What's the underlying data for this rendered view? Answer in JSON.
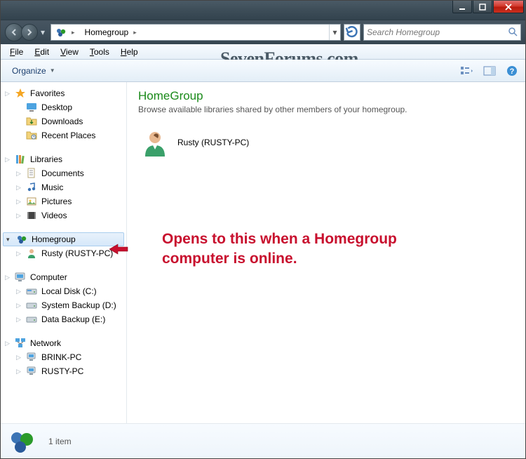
{
  "titlebar": {},
  "nav": {
    "breadcrumb_root_icon": "homegroup-icon",
    "breadcrumb": "Homegroup",
    "search_placeholder": "Search Homegroup"
  },
  "menu": {
    "file": "File",
    "edit": "Edit",
    "view": "View",
    "tools": "Tools",
    "help": "Help"
  },
  "watermark": "SevenForums.com",
  "toolbar": {
    "organize": "Organize"
  },
  "sidebar": {
    "favorites": {
      "label": "Favorites",
      "items": [
        "Desktop",
        "Downloads",
        "Recent Places"
      ]
    },
    "libraries": {
      "label": "Libraries",
      "items": [
        "Documents",
        "Music",
        "Pictures",
        "Videos"
      ]
    },
    "homegroup": {
      "label": "Homegroup",
      "items": [
        "Rusty (RUSTY-PC)"
      ]
    },
    "computer": {
      "label": "Computer",
      "items": [
        "Local Disk (C:)",
        "System Backup (D:)",
        "Data Backup (E:)"
      ]
    },
    "network": {
      "label": "Network",
      "items": [
        "BRINK-PC",
        "RUSTY-PC"
      ]
    }
  },
  "content": {
    "heading": "HomeGroup",
    "subhead": "Browse available libraries shared by other members of your homegroup.",
    "members": [
      {
        "name": "Rusty (RUSTY-PC)"
      }
    ]
  },
  "annotation": {
    "line1": "Opens to this when a Homegroup",
    "line2": "computer is online."
  },
  "status": {
    "count": "1 item"
  }
}
